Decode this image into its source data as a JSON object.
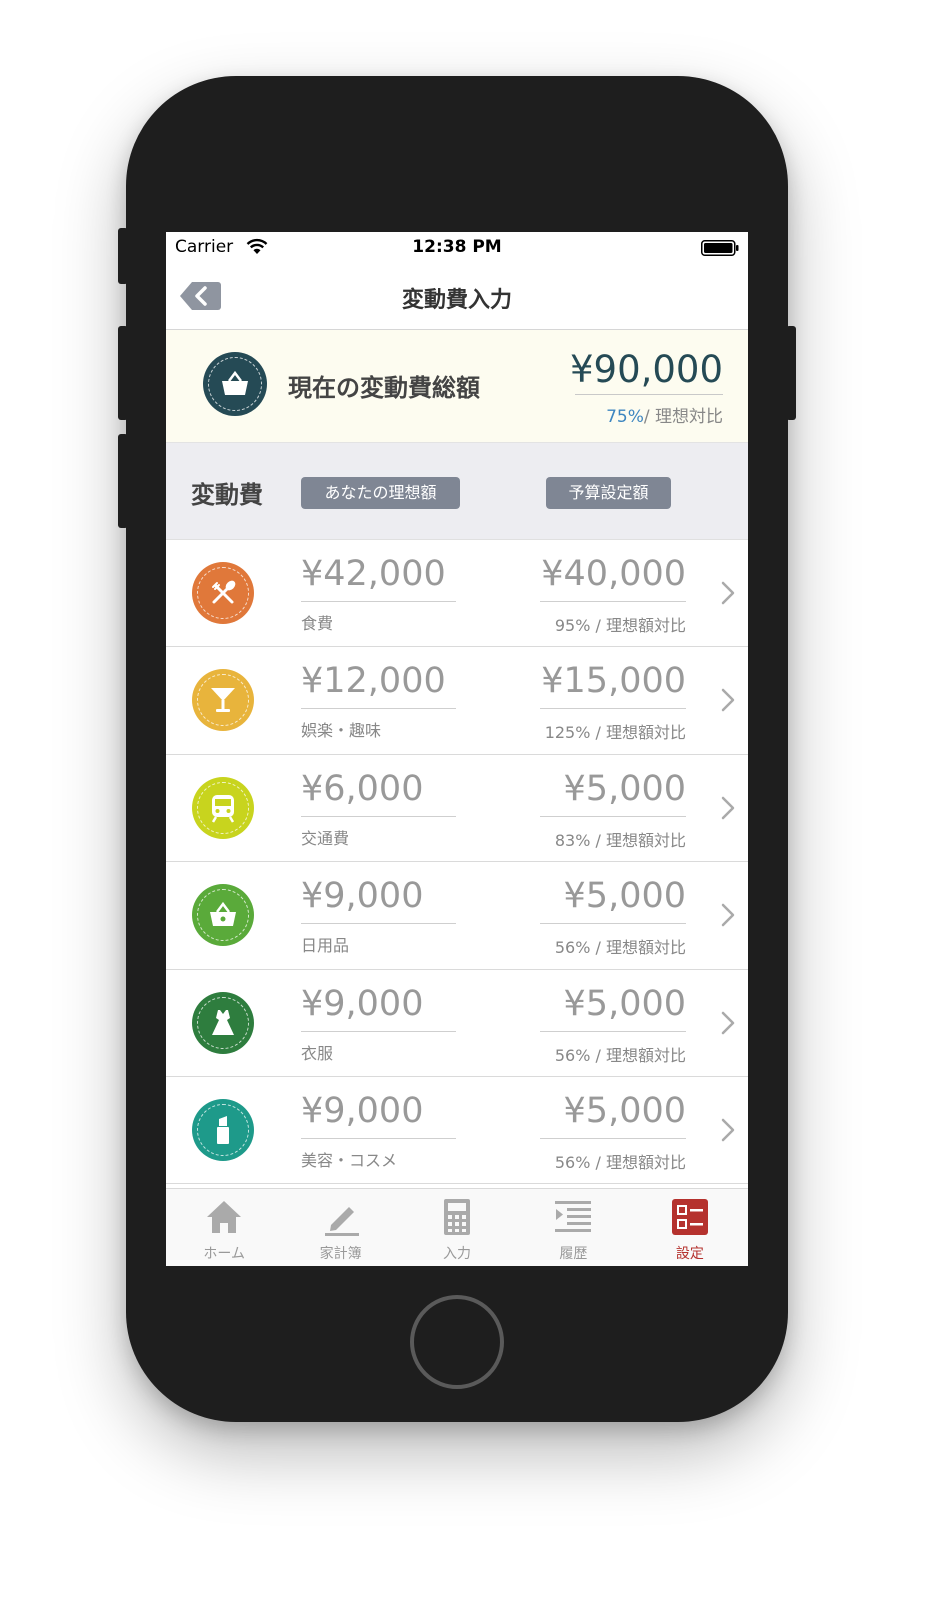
{
  "status_bar": {
    "carrier": "Carrier",
    "time": "12:38 PM"
  },
  "nav": {
    "title": "変動費入力"
  },
  "summary": {
    "label": "現在の変動費総額",
    "amount": "¥90,000",
    "percent": "75%",
    "ratio_suffix": "/ 理想対比",
    "icon": "basket-icon",
    "icon_color": "#254a55"
  },
  "list_header": {
    "title": "変動費",
    "ideal_tag": "あなたの理想額",
    "budget_tag": "予算設定額"
  },
  "categories": [
    {
      "name": "食費",
      "ideal": "¥42,000",
      "budget": "¥40,000",
      "ratio": "95% / 理想額対比",
      "icon": "fork-spoon-icon",
      "color": "#e0783a"
    },
    {
      "name": "娯楽・趣味",
      "ideal": "¥12,000",
      "budget": "¥15,000",
      "ratio": "125% / 理想額対比",
      "icon": "cocktail-icon",
      "color": "#e8b43c"
    },
    {
      "name": "交通費",
      "ideal": "¥6,000",
      "budget": "¥5,000",
      "ratio": "83% / 理想額対比",
      "icon": "train-icon",
      "color": "#c8d41e"
    },
    {
      "name": "日用品",
      "ideal": "¥9,000",
      "budget": "¥5,000",
      "ratio": "56% / 理想額対比",
      "icon": "basket-icon",
      "color": "#5aaa3a"
    },
    {
      "name": "衣服",
      "ideal": "¥9,000",
      "budget": "¥5,000",
      "ratio": "56% / 理想額対比",
      "icon": "dress-icon",
      "color": "#2e7d3e"
    },
    {
      "name": "美容・コスメ",
      "ideal": "¥9,000",
      "budget": "¥5,000",
      "ratio": "56% / 理想額対比",
      "icon": "lipstick-icon",
      "color": "#1e9a8a"
    }
  ],
  "tabbar": {
    "tabs": [
      {
        "label": "ホーム",
        "icon": "home-icon"
      },
      {
        "label": "家計簿",
        "icon": "pencil-icon"
      },
      {
        "label": "入力",
        "icon": "calculator-icon"
      },
      {
        "label": "履歴",
        "icon": "history-list-icon"
      },
      {
        "label": "設定",
        "icon": "settings-grid-icon"
      }
    ],
    "active_index": 4,
    "active_color": "#b5322e"
  }
}
